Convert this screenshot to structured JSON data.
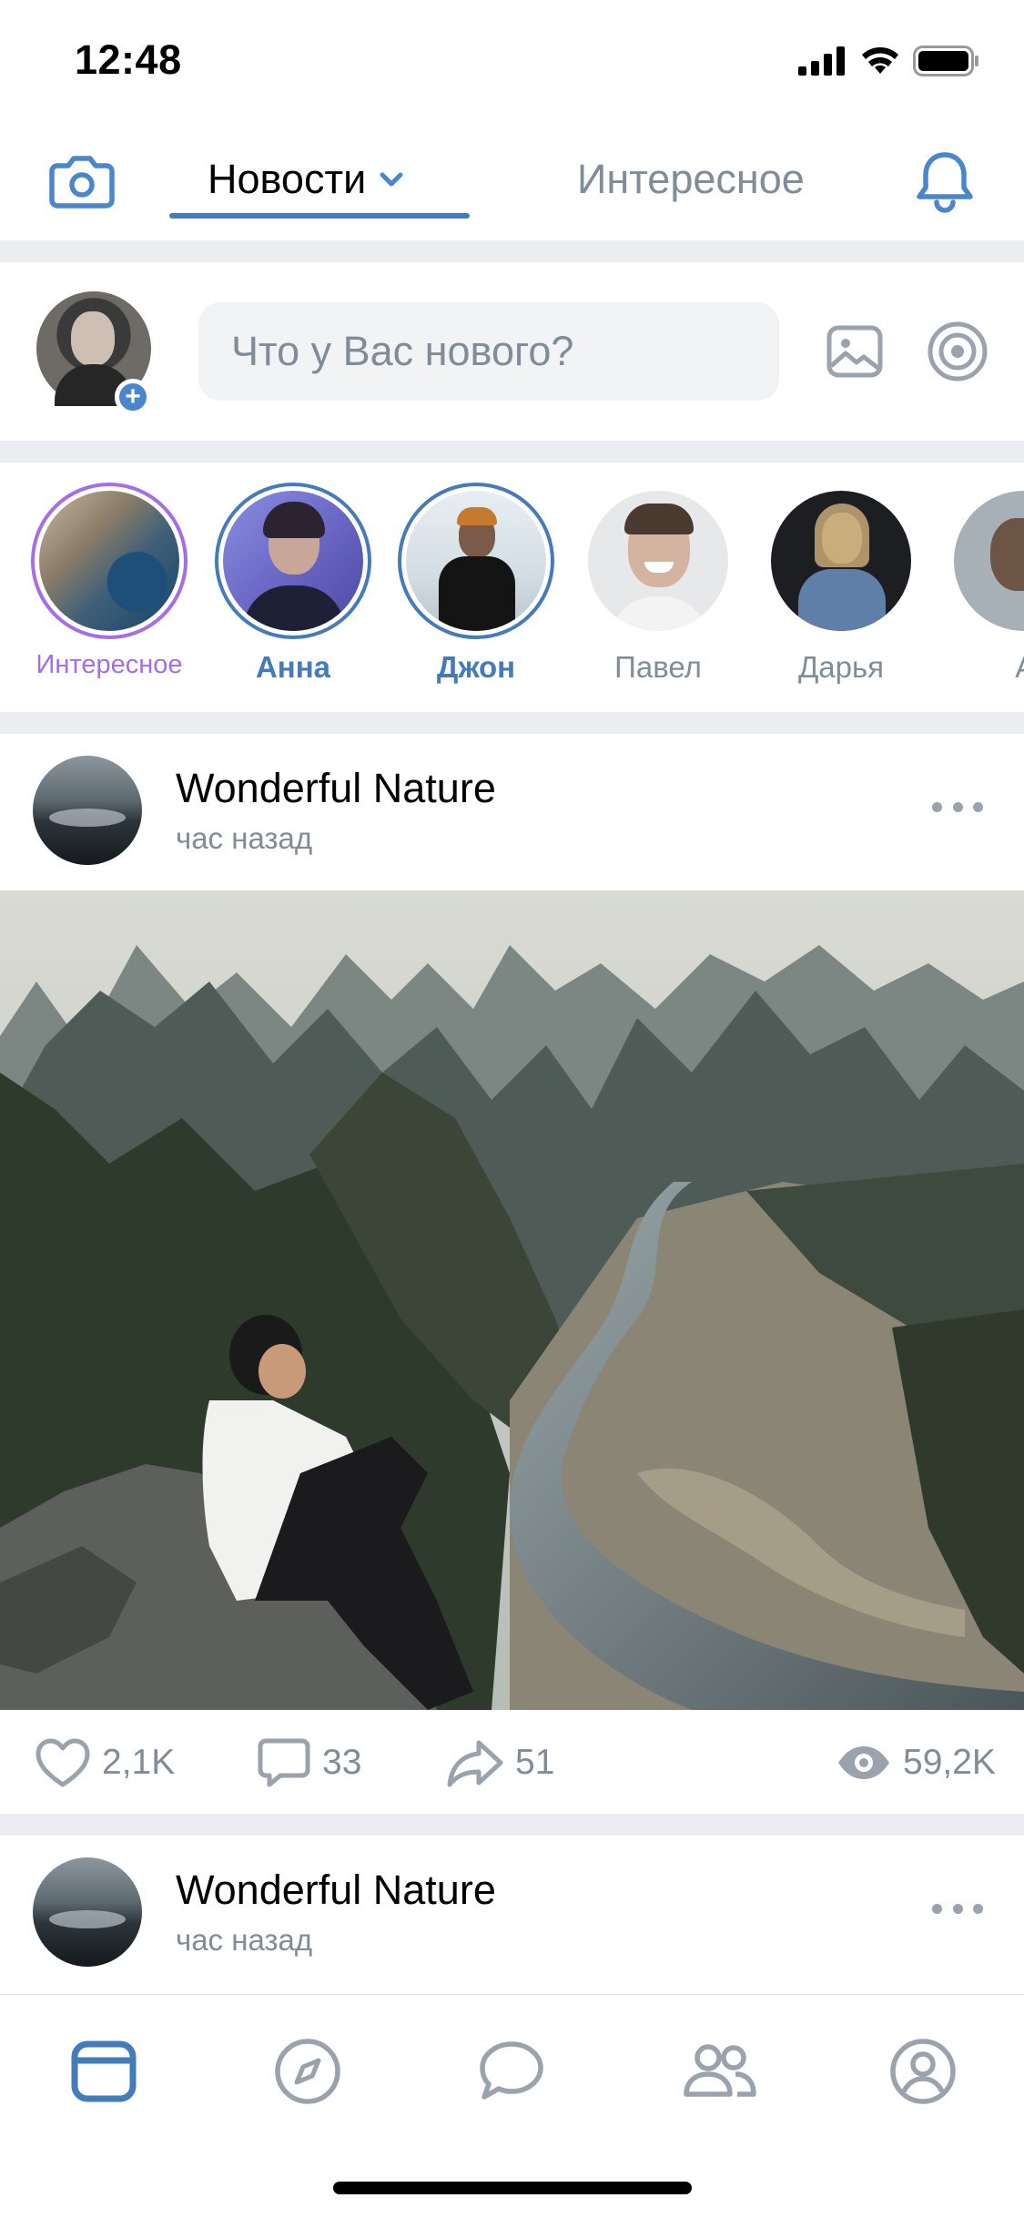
{
  "status_bar": {
    "time": "12:48"
  },
  "header": {
    "camera_icon": "camera-icon",
    "tab_news": "Новости",
    "tab_interesting": "Интересное",
    "bell_icon": "bell-icon"
  },
  "composer": {
    "placeholder": "Что у Вас нового?",
    "photo_icon": "image-icon",
    "target_icon": "target-icon"
  },
  "stories": [
    {
      "name": "Интересное",
      "ring": "purple"
    },
    {
      "name": "Анна",
      "ring": "blue"
    },
    {
      "name": "Джон",
      "ring": "blue"
    },
    {
      "name": "Павел",
      "ring": "none"
    },
    {
      "name": "Дарья",
      "ring": "none"
    },
    {
      "name": "Алё",
      "ring": "none"
    }
  ],
  "posts": [
    {
      "author": "Wonderful Nature",
      "time": "час назад",
      "likes": "2,1K",
      "comments": "33",
      "shares": "51",
      "views": "59,2K"
    },
    {
      "author": "Wonderful Nature",
      "time": "час назад"
    }
  ],
  "tabbar": {
    "items": [
      "news-icon",
      "compass-icon",
      "message-icon",
      "friends-icon",
      "profile-icon"
    ],
    "active_index": 0
  },
  "colors": {
    "accent": "#447bba",
    "muted": "#818c99",
    "separator": "#ebedf0",
    "story_purple": "#a76ce8"
  }
}
